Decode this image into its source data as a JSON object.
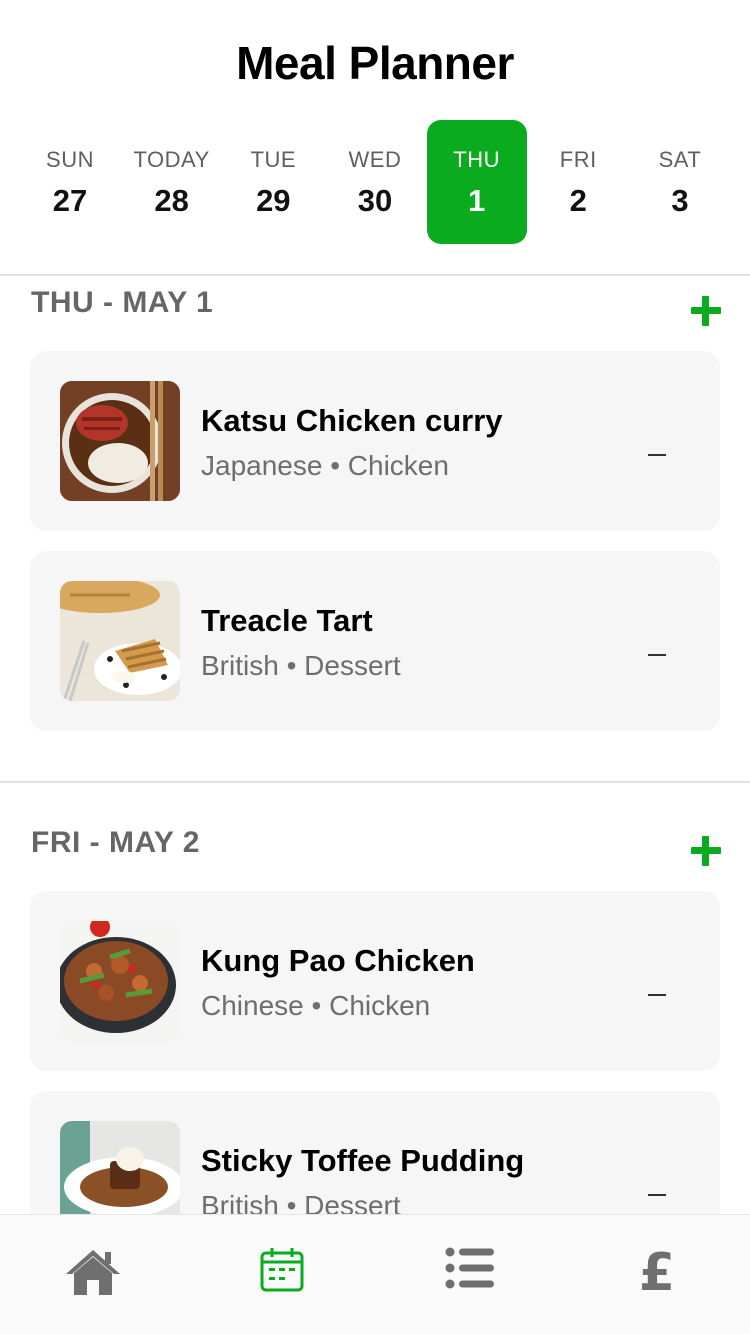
{
  "header": {
    "title": "Meal Planner"
  },
  "days": [
    {
      "name": "SUN",
      "num": "27"
    },
    {
      "name": "TODAY",
      "num": "28"
    },
    {
      "name": "TUE",
      "num": "29"
    },
    {
      "name": "WED",
      "num": "30"
    },
    {
      "name": "THU",
      "num": "1",
      "selected": true
    },
    {
      "name": "FRI",
      "num": "2"
    },
    {
      "name": "SAT",
      "num": "3"
    }
  ],
  "sections": [
    {
      "title": "THU - MAY 1",
      "meals": [
        {
          "name": "Katsu Chicken curry",
          "tags": "Japanese • Chicken",
          "image": "katsu-curry-photo"
        },
        {
          "name": "Treacle Tart",
          "tags": "British • Dessert",
          "image": "treacle-tart-photo"
        }
      ]
    },
    {
      "title": "FRI - MAY 2",
      "meals": [
        {
          "name": "Kung Pao Chicken",
          "tags": "Chinese • Chicken",
          "image": "kung-pao-photo"
        },
        {
          "name": "Sticky Toffee Pudding",
          "tags": "British • Dessert",
          "image": "toffee-pudding-photo"
        }
      ]
    }
  ],
  "tabbar": {
    "items": [
      {
        "icon": "home-icon",
        "active": false
      },
      {
        "icon": "calendar-icon",
        "active": true
      },
      {
        "icon": "list-icon",
        "active": false
      },
      {
        "icon": "pound-icon",
        "label": "£",
        "active": false
      }
    ]
  },
  "colors": {
    "accent": "#0aab1e",
    "inactive_icon": "#6f6f6f",
    "card_bg": "#f6f6f6",
    "muted_text": "#6e6e6e"
  }
}
